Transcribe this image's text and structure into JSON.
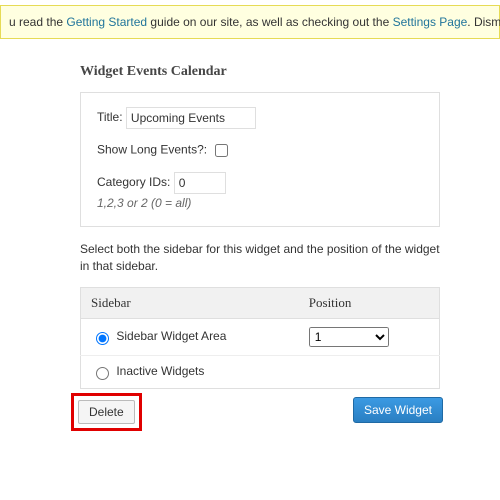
{
  "notice": {
    "pre": "u read the ",
    "link1": "Getting Started",
    "mid": " guide on our site, as well as checking out the ",
    "link2": "Settings Page",
    "post": ". Dism"
  },
  "widget": {
    "heading": "Widget Events Calendar",
    "title_label": "Title:",
    "title_value": "Upcoming Events",
    "long_events_label": "Show Long Events?:",
    "long_events_checked": false,
    "category_label": "Category IDs:",
    "category_value": "0",
    "category_hint": "1,2,3 or 2 (0 = all)"
  },
  "placement": {
    "desc": "Select both the sidebar for this widget and the position of the widget in that sidebar.",
    "col_sidebar": "Sidebar",
    "col_position": "Position",
    "rows": [
      {
        "label": "Sidebar Widget Area",
        "checked": true,
        "position": "1"
      },
      {
        "label": "Inactive Widgets",
        "checked": false,
        "position": ""
      }
    ]
  },
  "actions": {
    "delete": "Delete",
    "save": "Save Widget"
  }
}
